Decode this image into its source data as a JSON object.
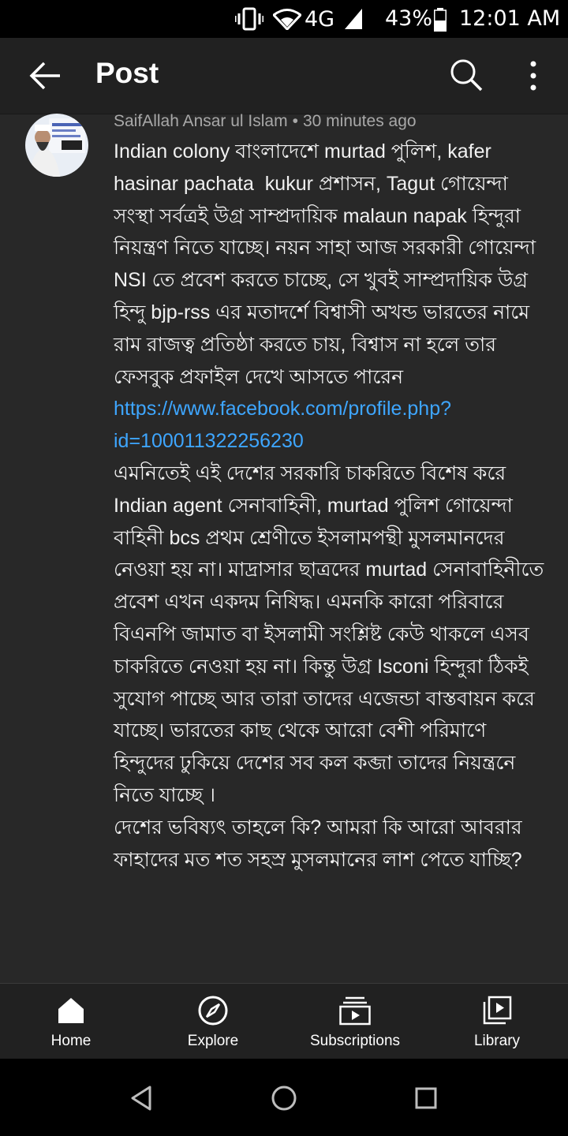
{
  "status_bar": {
    "network": "4G",
    "battery": "43%",
    "time": "12:01 AM",
    "icons": [
      "vibrate-icon",
      "wifi-icon",
      "signal-icon",
      "battery-icon"
    ]
  },
  "app_bar": {
    "title": "Post",
    "icons": [
      "back-arrow-icon",
      "search-icon",
      "more-vert-icon"
    ]
  },
  "post": {
    "author": "SaifAllah Ansar ul Islam",
    "separator": "•",
    "time_ago": "30 minutes ago",
    "text_part1": "Indian colony বাংলাদেশে murtad পুলিশ, kafer hasinar pachata  kukur প্রশাসন, Tagut গোয়েন্দা সংস্থা সর্বত্রই উগ্র সাম্প্রদায়িক malaun napak হিন্দুরা নিয়ন্ত্রণ নিতে যাচ্ছে। নয়ন সাহা আজ সরকারী গোয়েন্দা NSI তে প্রবেশ করতে চাচ্ছে, সে খুবই সাম্প্রদায়িক উগ্র হিন্দু bjp-rss এর মতাদর্শে বিশ্বাসী অখন্ড ভারতের নামে রাম রাজত্ব প্রতিষ্ঠা করতে চায়, বিশ্বাস না হলে তার ফেসবুক প্রফাইল দেখে আসতে পারেন ",
    "link": "https://www.facebook.com/profile.php?id=100011322256230",
    "text_part2": "\nএমনিতেই এই দেশের সরকারি চাকরিতে বিশেষ করে Indian agent সেনাবাহিনী, murtad পুলিশ গোয়েন্দা বাহিনী bcs প্রথম শ্রেণীতে ইসলামপন্থী মুসলমানদের নেওয়া হয় না। মাদ্রাসার ছাত্রদের murtad সেনাবাহিনীতে প্রবেশ এখন একদম নিষিদ্ধ। এমনকি কারো পরিবারে বিএনপি জামাত বা ইসলামী সংশ্লিষ্ট কেউ থাকলে এসব চাকরিতে নেওয়া হয় না। কিন্তু উগ্র Isconi হিন্দুরা ঠিকই সুযোগ পাচ্ছে আর তারা তাদের এজেন্ডা বাস্তবায়ন করে যাচ্ছে। ভারতের কাছ থেকে আরো বেশী পরিমাণে হিন্দুদের ঢুকিয়ে দেশের সব কল কব্জা তাদের নিয়ন্ত্রনে নিতে যাচ্ছে ।\nদেশের ভবিষ্যৎ তাহলে কি? আমরা কি আরো আবরার ফাহাদের মত শত সহস্র মুসলমানের লাশ পেতে যাচ্ছি?",
    "avatar_icon": "avatar-image"
  },
  "bottom_nav": {
    "items": [
      {
        "label": "Home",
        "icon": "home-icon"
      },
      {
        "label": "Explore",
        "icon": "explore-compass-icon"
      },
      {
        "label": "Subscriptions",
        "icon": "subscriptions-icon"
      },
      {
        "label": "Library",
        "icon": "library-icon"
      }
    ]
  },
  "system_nav": {
    "icons": [
      "back-triangle-icon",
      "home-circle-icon",
      "recents-square-icon"
    ]
  }
}
